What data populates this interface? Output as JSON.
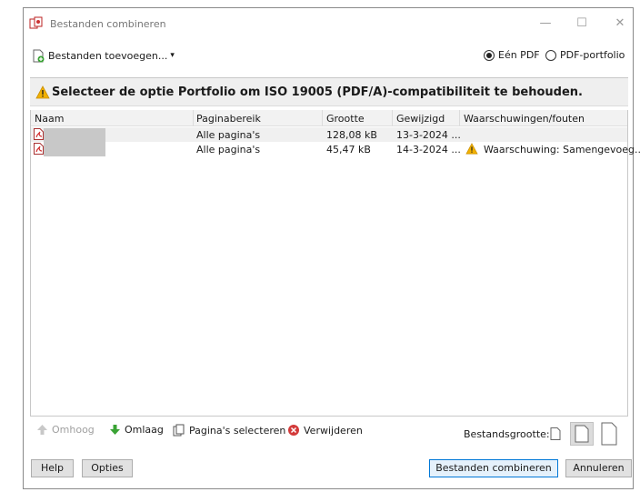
{
  "window": {
    "title": "Bestanden combineren",
    "controls": {
      "minimize": "—",
      "maximize": "☐",
      "close": "✕"
    }
  },
  "toolbar": {
    "add_files_label": "Bestanden toevoegen...",
    "add_files_caret": "▾",
    "radio_single": {
      "label": "Eén PDF",
      "checked": true
    },
    "radio_portfolio": {
      "label": "PDF-portfolio",
      "checked": false
    }
  },
  "warning": {
    "icon": "warning-icon",
    "text": "Selecteer de optie Portfolio om ISO 19005 (PDF/A)-compatibiliteit te behouden."
  },
  "table": {
    "columns": [
      "Naam",
      "Paginabereik",
      "Grootte",
      "Gewijzigd",
      "Waarschuwingen/fouten"
    ],
    "rows": [
      {
        "name": "",
        "pages": "Alle pagina's",
        "size": "128,08 kB",
        "modified": "13-3-2024 ...",
        "warning": ""
      },
      {
        "name": "",
        "pages": "Alle pagina's",
        "size": "45,47 kB",
        "modified": "14-3-2024 ...",
        "warning": "Waarschuwing: Samengevoeg..."
      }
    ]
  },
  "tools": {
    "up": "Omhoog",
    "down": "Omlaag",
    "select_pages": "Pagina's selecteren",
    "delete": "Verwijderen",
    "file_size_label": "Bestandsgrootte:"
  },
  "footer": {
    "help": "Help",
    "options": "Opties",
    "combine": "Bestanden combineren",
    "cancel": "Annuleren"
  },
  "colors": {
    "accent": "#0078d7",
    "warning": "#f2b100",
    "pdf_red": "#d32f2f",
    "down_arrow": "#3aa335",
    "delete_red": "#d33a3a"
  }
}
